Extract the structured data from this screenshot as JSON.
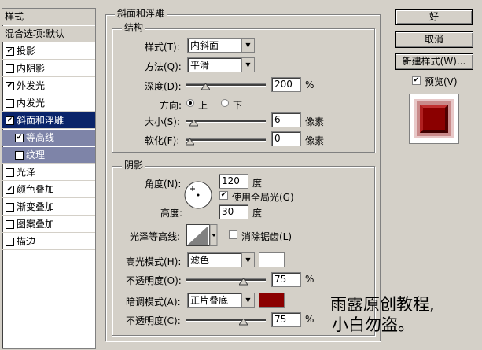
{
  "sidebar": {
    "items": [
      {
        "label": "样式",
        "type": "header"
      },
      {
        "label": "混合选项:默认",
        "type": "header"
      },
      {
        "label": "投影",
        "checked": true
      },
      {
        "label": "内阴影",
        "checked": false
      },
      {
        "label": "外发光",
        "checked": true
      },
      {
        "label": "内发光",
        "checked": false
      },
      {
        "label": "斜面和浮雕",
        "checked": true,
        "selected": true
      },
      {
        "label": "等高线",
        "checked": true,
        "sub": true
      },
      {
        "label": "纹理",
        "checked": false,
        "sub": true
      },
      {
        "label": "光泽",
        "checked": false
      },
      {
        "label": "颜色叠加",
        "checked": true
      },
      {
        "label": "渐变叠加",
        "checked": false
      },
      {
        "label": "图案叠加",
        "checked": false
      },
      {
        "label": "描边",
        "checked": false
      }
    ]
  },
  "bevel": {
    "title": "斜面和浮雕",
    "structure": {
      "title": "结构",
      "style_label": "样式(T):",
      "style_value": "内斜面",
      "technique_label": "方法(Q):",
      "technique_value": "平滑",
      "depth_label": "深度(D):",
      "depth_value": "200",
      "depth_unit": "%",
      "depth_slider": 0.22,
      "direction_label": "方向:",
      "direction_up": "上",
      "direction_down": "下",
      "size_label": "大小(S):",
      "size_value": "6",
      "size_unit": "像素",
      "size_slider": 0.05,
      "soften_label": "软化(F):",
      "soften_value": "0",
      "soften_unit": "像素",
      "soften_slider": 0.0
    },
    "shading": {
      "title": "阴影",
      "angle_label": "角度(N):",
      "angle_value": "120",
      "angle_unit": "度",
      "global_light_label": "使用全局光(G)",
      "global_light_checked": true,
      "altitude_label": "高度:",
      "altitude_value": "30",
      "altitude_unit": "度",
      "gloss_label": "光泽等高线:",
      "anti_alias_label": "消除锯齿(L)",
      "highlight_mode_label": "高光模式(H):",
      "highlight_mode_value": "滤色",
      "highlight_color": "#ffffff",
      "highlight_opacity_label": "不透明度(O):",
      "highlight_opacity_value": "75",
      "highlight_opacity_unit": "%",
      "highlight_opacity_slider": 0.75,
      "shadow_mode_label": "暗调模式(A):",
      "shadow_mode_value": "正片叠底",
      "shadow_color": "#8b0000",
      "shadow_opacity_label": "不透明度(C):",
      "shadow_opacity_value": "75",
      "shadow_opacity_unit": "%",
      "shadow_opacity_slider": 0.75
    }
  },
  "buttons": {
    "ok": "好",
    "cancel": "取消",
    "new_style": "新建样式(W)...",
    "preview_label": "预览(V)",
    "preview_checked": true
  },
  "watermark": {
    "line1": "雨露原创教程,",
    "line2": "小白勿盗。"
  }
}
